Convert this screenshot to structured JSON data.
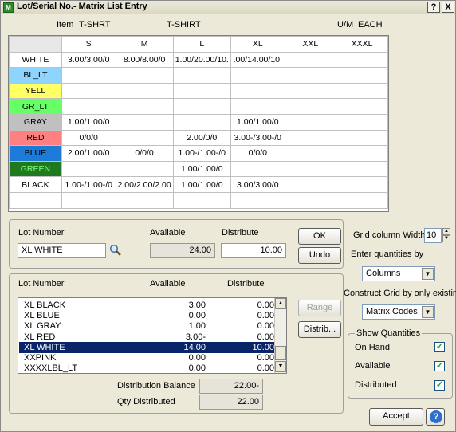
{
  "window": {
    "title": "Lot/Serial No.- Matrix List Entry",
    "help_btn": "?",
    "close_btn": "X"
  },
  "header": {
    "item_label": "Item",
    "item_value": "T-SHRT",
    "item_desc": "T-SHIRT",
    "um_label": "U/M",
    "um_value": "EACH"
  },
  "grid": {
    "columns": [
      "S",
      "M",
      "L",
      "XL",
      "XXL",
      "XXXL"
    ],
    "rows": [
      {
        "label": "WHITE",
        "color": "#ffffff",
        "cells": [
          "3.00/3.00/0",
          "8.00/8.00/0",
          "1.00/20.00/10.",
          ".00/14.00/10.",
          "",
          ""
        ]
      },
      {
        "label": "BL_LT",
        "color": "#8fd3ff",
        "cells": [
          "",
          "",
          "",
          "",
          "",
          ""
        ]
      },
      {
        "label": "YELL",
        "color": "#ffff66",
        "cells": [
          "",
          "",
          "",
          "",
          "",
          ""
        ]
      },
      {
        "label": "GR_LT",
        "color": "#66ff66",
        "cells": [
          "",
          "",
          "",
          "",
          "",
          ""
        ]
      },
      {
        "label": "GRAY",
        "color": "#c0c0c0",
        "cells": [
          "1.00/1.00/0",
          "",
          "",
          "1.00/1.00/0",
          "",
          ""
        ]
      },
      {
        "label": "RED",
        "color": "#ff8080",
        "cells": [
          "0/0/0",
          "",
          "2.00/0/0",
          "3.00-/3.00-/0",
          "",
          ""
        ]
      },
      {
        "label": "BLUE",
        "color": "#1c7ad8",
        "cells": [
          "2.00/1.00/0",
          "0/0/0",
          "1.00-/1.00-/0",
          "0/0/0",
          "",
          ""
        ]
      },
      {
        "label": "GREEN",
        "color": "#1f7a1f",
        "cells": [
          "",
          "",
          "1.00/1.00/0",
          "",
          "",
          ""
        ]
      },
      {
        "label": "BLACK",
        "color": "#ffffff",
        "cells": [
          "1.00-/1.00-/0",
          "2.00/2.00/2.00",
          "1.00/1.00/0",
          "3.00/3.00/0",
          "",
          ""
        ]
      }
    ]
  },
  "lot_entry": {
    "lot_label": "Lot Number",
    "lot_value": "XL  WHITE",
    "available_label": "Available",
    "available_value": "24.00",
    "distribute_label": "Distribute",
    "distribute_value": "10.00"
  },
  "buttons": {
    "ok": "OK",
    "undo": "Undo",
    "range": "Range",
    "distrib": "Distrib...",
    "accept": "Accept"
  },
  "list": {
    "headers": {
      "lot": "Lot Number",
      "available": "Available",
      "distribute": "Distribute"
    },
    "rows": [
      {
        "lot": "XL   BLACK",
        "available": "3.00",
        "distribute": "0.00"
      },
      {
        "lot": "XL   BLUE",
        "available": "0.00",
        "distribute": "0.00"
      },
      {
        "lot": "XL   GRAY",
        "available": "1.00",
        "distribute": "0.00"
      },
      {
        "lot": "XL   RED",
        "available": "3.00-",
        "distribute": "0.00"
      },
      {
        "lot": "XL   WHITE",
        "available": "14.00",
        "distribute": "10.00"
      },
      {
        "lot": "XXPINK",
        "available": "0.00",
        "distribute": "0.00"
      },
      {
        "lot": "XXXXLBL_LT",
        "available": "0.00",
        "distribute": "0.00"
      }
    ],
    "selected_index": 4
  },
  "totals": {
    "balance_label": "Distribution Balance",
    "balance_value": "22.00-",
    "qty_label": "Qty Distributed",
    "qty_value": "22.00"
  },
  "options": {
    "grid_width_label": "Grid column Width",
    "grid_width_value": "10",
    "enter_by_label": "Enter quantities by",
    "enter_by_value": "Columns",
    "construct_label": "Construct Grid by only existing",
    "construct_value": "Matrix Codes",
    "show_qty_label": "Show Quantities",
    "on_hand_label": "On Hand",
    "available_label": "Available",
    "distributed_label": "Distributed"
  },
  "icons": {
    "title": "app-icon",
    "lookup": "magnifier-icon",
    "help": "help-icon"
  }
}
